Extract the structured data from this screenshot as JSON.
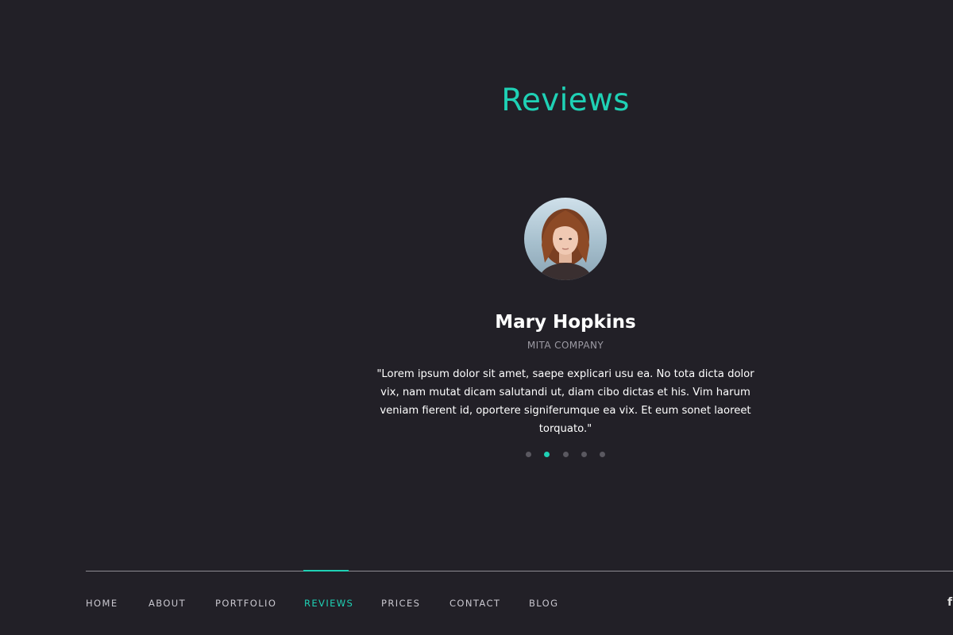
{
  "colors": {
    "background": "#222027",
    "accent": "#1fd1b5",
    "muted_text": "#9c9aa3",
    "nav_text": "#c9c7cf",
    "dot_inactive": "#5a5860",
    "rule": "#8d8b93"
  },
  "section": {
    "title": "Reviews"
  },
  "review": {
    "avatar_icon": "woman-portrait",
    "name": "Mary Hopkins",
    "company": "MITA COMPANY",
    "text": "\"Lorem ipsum dolor sit amet, saepe explicari usu ea. No tota dicta dolor vix, nam mutat dicam salutandi ut, diam cibo dictas et his. Vim harum veniam fierent id, oportere signiferumque ea vix. Et eum sonet laoreet torquato.\""
  },
  "pagination": {
    "total": 5,
    "active_index": 1
  },
  "nav": {
    "items": [
      {
        "label": "HOME",
        "active": false
      },
      {
        "label": "ABOUT",
        "active": false
      },
      {
        "label": "PORTFOLIO",
        "active": false
      },
      {
        "label": "REVIEWS",
        "active": true
      },
      {
        "label": "PRICES",
        "active": false
      },
      {
        "label": "CONTACT",
        "active": false
      },
      {
        "label": "BLOG",
        "active": false
      }
    ]
  },
  "social": {
    "icon": "facebook-icon",
    "glyph": "f"
  }
}
